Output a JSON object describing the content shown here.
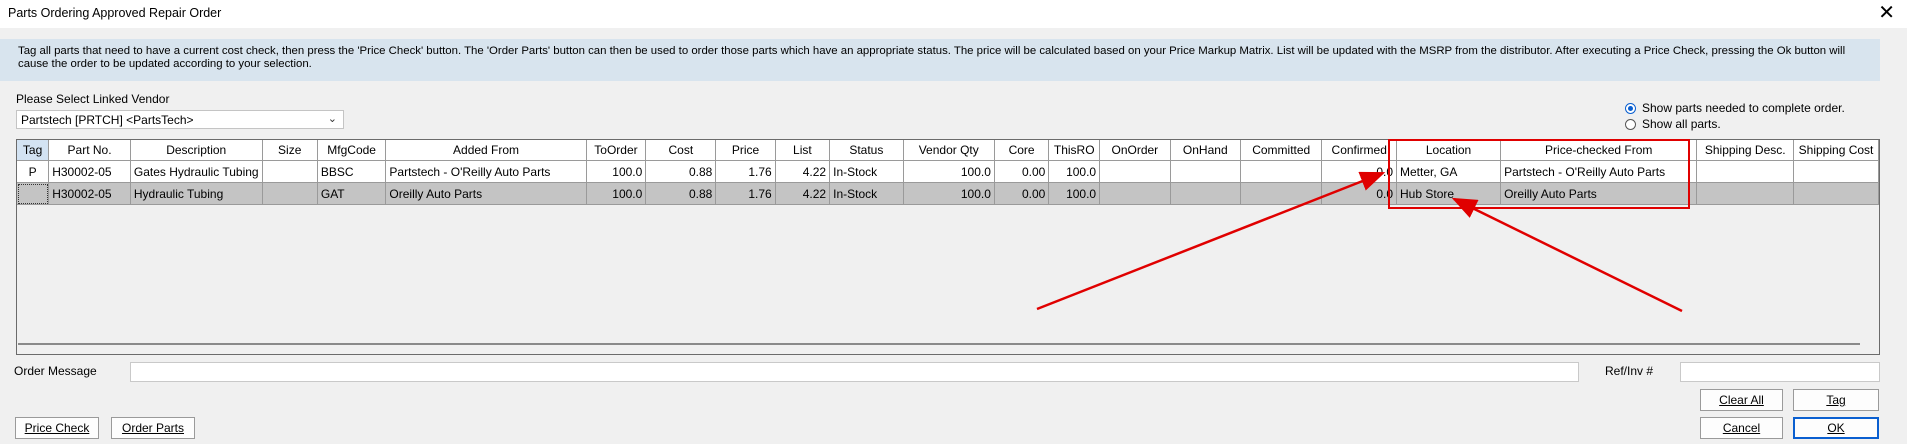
{
  "window": {
    "title": "Parts Ordering Approved Repair Order"
  },
  "info_text": "Tag all parts that need to have a current cost check, then press the 'Price Check' button.  The 'Order Parts' button can then be used to order those parts which have an appropriate status.  The price will be calculated based on your Price Markup Matrix. List will be updated with the MSRP from the distributor.  After executing a Price Check, pressing the Ok button will cause the order to be updated according to your selection.",
  "vendor": {
    "label": "Please Select Linked Vendor",
    "value": "Partstech [PRTCH] <PartsTech>"
  },
  "radios": {
    "opt1": "Show parts needed to complete order.",
    "opt2": "Show all parts.",
    "selected": "opt1"
  },
  "columns": [
    "Tag",
    "Part No.",
    "Description",
    "Size",
    "MfgCode",
    "Added From",
    "ToOrder",
    "Cost",
    "Price",
    "List",
    "Status",
    "Vendor Qty",
    "Core",
    "ThisRO",
    "OnOrder",
    "OnHand",
    "Committed",
    "Confirmed",
    "Location",
    "Price-checked From",
    "Shipping Desc.",
    "Shipping Cost"
  ],
  "rows": [
    [
      "P",
      "H30002-05",
      "Gates Hydraulic Tubing",
      "",
      "BBSC",
      "Partstech - O'Reilly Auto Parts",
      "100.0",
      "0.88",
      "1.76",
      "4.22",
      "In-Stock",
      "100.0",
      "0.00",
      "100.0",
      "",
      "",
      "",
      "0.0",
      "Metter, GA",
      "Partstech - O'Reilly Auto Parts",
      "",
      ""
    ],
    [
      "",
      "H30002-05",
      "Hydraulic Tubing",
      "",
      "GAT",
      "Oreilly Auto Parts",
      "100.0",
      "0.88",
      "1.76",
      "4.22",
      "In-Stock",
      "100.0",
      "0.00",
      "100.0",
      "",
      "",
      "",
      "0.0",
      "Hub Store",
      "Oreilly Auto Parts",
      "",
      ""
    ]
  ],
  "order_message": {
    "label": "Order Message",
    "value": ""
  },
  "ref_inv": {
    "label": "Ref/Inv #",
    "value": ""
  },
  "buttons": {
    "price_check": "Price Check",
    "order_parts": "Order Parts",
    "clear_all": "Clear All",
    "tag": "Tag",
    "cancel": "Cancel",
    "ok": "OK"
  },
  "colors": {
    "highlight_red": "#e00000",
    "info_bg": "#d8e4ee",
    "selected_row": "#c4c4c4"
  }
}
